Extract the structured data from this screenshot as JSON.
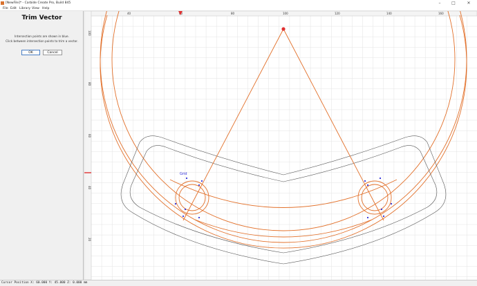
{
  "window": {
    "title": "[NewFile]* - Carbide Create Pro, Build 845",
    "icon": "carbide-create-app-icon",
    "controls": {
      "minimize": "–",
      "maximize": "□",
      "close": "✕"
    }
  },
  "menu": {
    "file": "File",
    "edit": "Edit",
    "library": "Library",
    "view": "View",
    "help": "Help"
  },
  "panel": {
    "title": "Trim Vector",
    "line1": "Intersection points are shown in blue.",
    "line2": "Click between intersection points to trim a vector.",
    "ok": "OK",
    "cancel": "Cancel"
  },
  "canvas": {
    "top_ruler": [
      "40",
      "60",
      "80",
      "100",
      "120",
      "140",
      "160"
    ],
    "left_ruler": [
      "100",
      "80",
      "60",
      "40",
      "20"
    ],
    "label": "Grid",
    "colors": {
      "orange": "#e2702a",
      "gray": "#555555",
      "blue": "#2a2ad8",
      "grid": "#e3e3e3",
      "marker": "#e03030"
    }
  },
  "status": {
    "text": "Cursor Position X: 60.000 Y: 45.000 Z: 0.000 mm"
  }
}
